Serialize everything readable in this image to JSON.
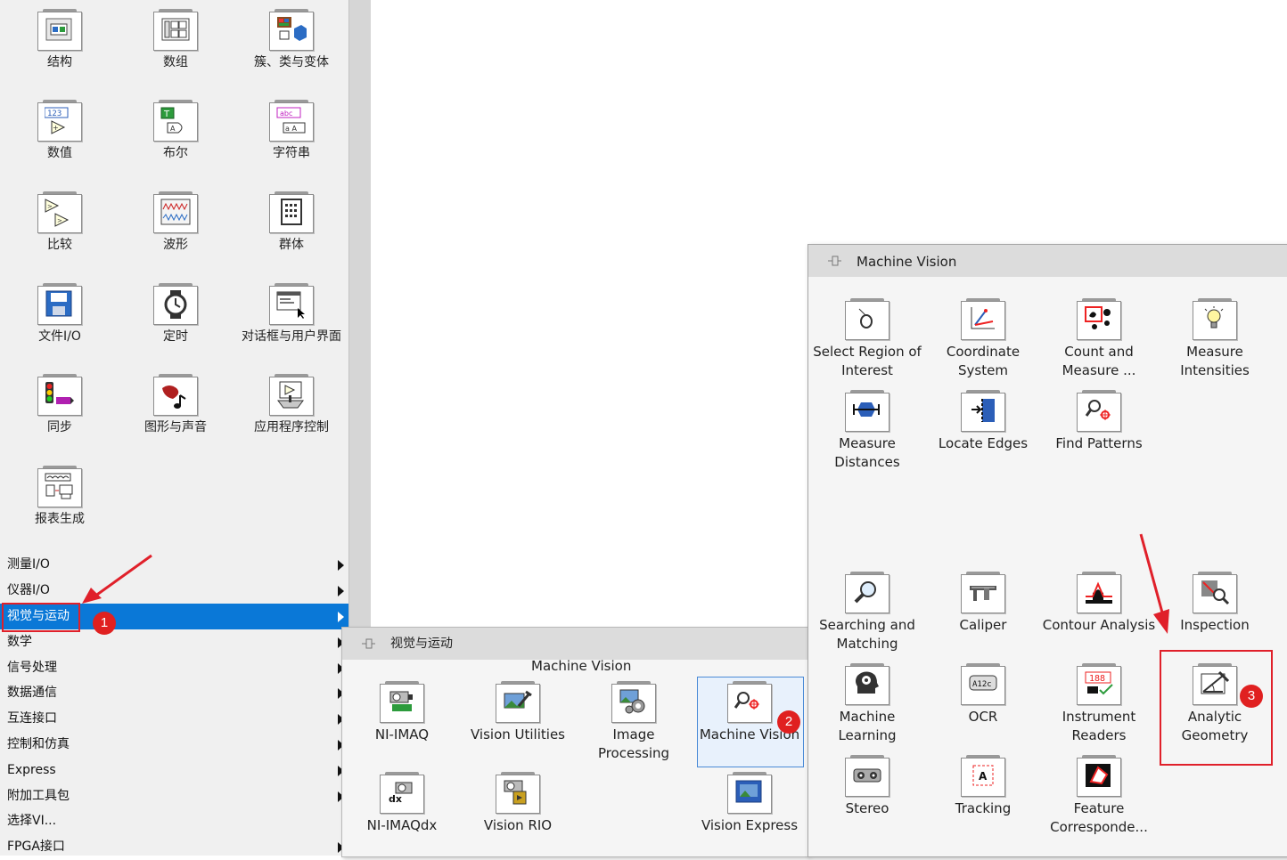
{
  "palette": {
    "items": [
      {
        "label": "结构",
        "icon": "structure-icon"
      },
      {
        "label": "数组",
        "icon": "array-icon"
      },
      {
        "label": "簇、类与变体",
        "icon": "cluster-class-variant-icon"
      },
      {
        "label": "数值",
        "icon": "numeric-icon"
      },
      {
        "label": "布尔",
        "icon": "boolean-icon"
      },
      {
        "label": "字符串",
        "icon": "string-icon"
      },
      {
        "label": "比较",
        "icon": "comparison-icon"
      },
      {
        "label": "波形",
        "icon": "waveform-icon"
      },
      {
        "label": "群体",
        "icon": "synchronization-cluster-icon"
      },
      {
        "label": "文件I/O",
        "icon": "file-io-icon"
      },
      {
        "label": "定时",
        "icon": "timing-icon"
      },
      {
        "label": "对话框与用户界面",
        "icon": "dialog-ui-icon"
      },
      {
        "label": "同步",
        "icon": "synchronization-icon"
      },
      {
        "label": "图形与声音",
        "icon": "graphics-sound-icon"
      },
      {
        "label": "应用程序控制",
        "icon": "application-control-icon"
      },
      {
        "label": "报表生成",
        "icon": "report-generation-icon"
      }
    ]
  },
  "menu": {
    "items": [
      {
        "label": "测量I/O",
        "has_arrow": true
      },
      {
        "label": "仪器I/O",
        "has_arrow": true
      },
      {
        "label": "视觉与运动",
        "has_arrow": true,
        "selected": true
      },
      {
        "label": "数学",
        "has_arrow": true
      },
      {
        "label": "信号处理",
        "has_arrow": true
      },
      {
        "label": "数据通信",
        "has_arrow": true
      },
      {
        "label": "互连接口",
        "has_arrow": true
      },
      {
        "label": "控制和仿真",
        "has_arrow": true
      },
      {
        "label": "Express",
        "has_arrow": true
      },
      {
        "label": "附加工具包",
        "has_arrow": true
      },
      {
        "label": "选择VI...",
        "has_arrow": false
      },
      {
        "label": "FPGA接口",
        "has_arrow": true
      }
    ],
    "selected_color": "#0a78d7"
  },
  "vision_submenu": {
    "title": "视觉与运动",
    "group_label": "Machine Vision",
    "items": [
      {
        "label": "NI-IMAQ",
        "icon": "ni-imaq-icon"
      },
      {
        "label": "Vision Utilities",
        "icon": "vision-utilities-icon"
      },
      {
        "label": "Image Processing",
        "icon": "image-processing-icon"
      },
      {
        "label": "Machine Vision",
        "icon": "machine-vision-icon",
        "focused": true
      },
      {
        "label": "NI-IMAQdx",
        "icon": "ni-imaqdx-icon"
      },
      {
        "label": "Vision RIO",
        "icon": "vision-rio-icon"
      },
      {
        "label": "Vision Express",
        "icon": "vision-express-icon"
      }
    ]
  },
  "machine_vision_panel": {
    "title": "Machine Vision",
    "items": [
      {
        "label": "Select Region of Interest",
        "icon": "select-roi-icon"
      },
      {
        "label": "Coordinate System",
        "icon": "coordinate-system-icon"
      },
      {
        "label": "Count and Measure ...",
        "icon": "count-measure-icon"
      },
      {
        "label": "Measure Intensities",
        "icon": "measure-intensities-icon"
      },
      {
        "label": "Measure Distances",
        "icon": "measure-distances-icon"
      },
      {
        "label": "Locate Edges",
        "icon": "locate-edges-icon"
      },
      {
        "label": "Find Patterns",
        "icon": "find-patterns-icon"
      },
      {
        "label": "Searching and Matching",
        "icon": "searching-matching-icon"
      },
      {
        "label": "Caliper",
        "icon": "caliper-icon"
      },
      {
        "label": "Contour Analysis",
        "icon": "contour-analysis-icon"
      },
      {
        "label": "Inspection",
        "icon": "inspection-icon"
      },
      {
        "label": "Machine Learning",
        "icon": "machine-learning-icon"
      },
      {
        "label": "OCR",
        "icon": "ocr-icon"
      },
      {
        "label": "Instrument Readers",
        "icon": "instrument-readers-icon"
      },
      {
        "label": "Analytic Geometry",
        "icon": "analytic-geometry-icon",
        "highlighted": true
      },
      {
        "label": "Stereo",
        "icon": "stereo-icon"
      },
      {
        "label": "Tracking",
        "icon": "tracking-icon"
      },
      {
        "label": "Feature Corresponde...",
        "icon": "feature-correspondence-icon"
      }
    ]
  },
  "annotations": {
    "badges": [
      "1",
      "2",
      "3"
    ],
    "color": "#e0202a"
  }
}
